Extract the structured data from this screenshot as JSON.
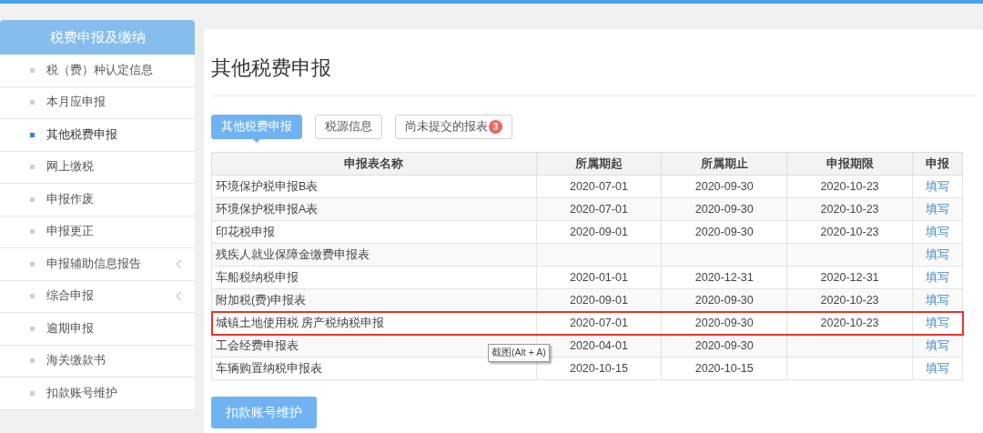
{
  "sidebar": {
    "title": "税费申报及缴纳",
    "items": [
      {
        "label": "税（费）种认定信息",
        "selected": false,
        "expandable": false
      },
      {
        "label": "本月应申报",
        "selected": false,
        "expandable": false
      },
      {
        "label": "其他税费申报",
        "selected": true,
        "expandable": false
      },
      {
        "label": "网上缴税",
        "selected": false,
        "expandable": false
      },
      {
        "label": "申报作废",
        "selected": false,
        "expandable": false
      },
      {
        "label": "申报更正",
        "selected": false,
        "expandable": false
      },
      {
        "label": "申报辅助信息报告",
        "selected": false,
        "expandable": true
      },
      {
        "label": "综合申报",
        "selected": false,
        "expandable": true
      },
      {
        "label": "逾期申报",
        "selected": false,
        "expandable": false
      },
      {
        "label": "海关缴款书",
        "selected": false,
        "expandable": false
      },
      {
        "label": "扣款账号维护",
        "selected": false,
        "expandable": false
      }
    ]
  },
  "page_title": "其他税费申报",
  "tabs": [
    {
      "label": "其他税费申报",
      "selected": true
    },
    {
      "label": "税源信息",
      "selected": false
    },
    {
      "label": "尚未提交的报表",
      "selected": false,
      "badge": "3"
    }
  ],
  "table": {
    "columns": [
      "申报表名称",
      "所属期起",
      "所属期止",
      "申报期限",
      "申报"
    ],
    "rows": [
      {
        "name": "环境保护税申报B表",
        "start": "2020-07-01",
        "end": "2020-09-30",
        "deadline": "2020-10-23",
        "action": "填写",
        "highlighted": false
      },
      {
        "name": "环境保护税申报A表",
        "start": "2020-07-01",
        "end": "2020-09-30",
        "deadline": "2020-10-23",
        "action": "填写",
        "highlighted": false
      },
      {
        "name": "印花税申报",
        "start": "2020-09-01",
        "end": "2020-09-30",
        "deadline": "2020-10-23",
        "action": "填写",
        "highlighted": false
      },
      {
        "name": "残疾人就业保障金缴费申报表",
        "action": "填写",
        "highlighted": false
      },
      {
        "name": "车船税纳税申报",
        "start": "2020-01-01",
        "end": "2020-12-31",
        "deadline": "2020-12-31",
        "action": "填写",
        "highlighted": false
      },
      {
        "name": "附加税(费)申报表",
        "start": "2020-09-01",
        "end": "2020-09-30",
        "deadline": "2020-10-23",
        "action": "填写",
        "highlighted": false
      },
      {
        "name": "城镇土地使用税 房产税纳税申报",
        "start": "2020-07-01",
        "end": "2020-09-30",
        "deadline": "2020-10-23",
        "action": "填写",
        "highlighted": true
      },
      {
        "name": "工会经费申报表",
        "start": "2020-04-01",
        "end": "2020-09-30",
        "action": "填写",
        "highlighted": false
      },
      {
        "name": "车辆购置纳税申报表",
        "start": "2020-10-15",
        "end": "2020-10-15",
        "action": "填写",
        "highlighted": false
      }
    ]
  },
  "tooltip": "截图(Alt + A)",
  "bottom_button": "扣款账号维护"
}
